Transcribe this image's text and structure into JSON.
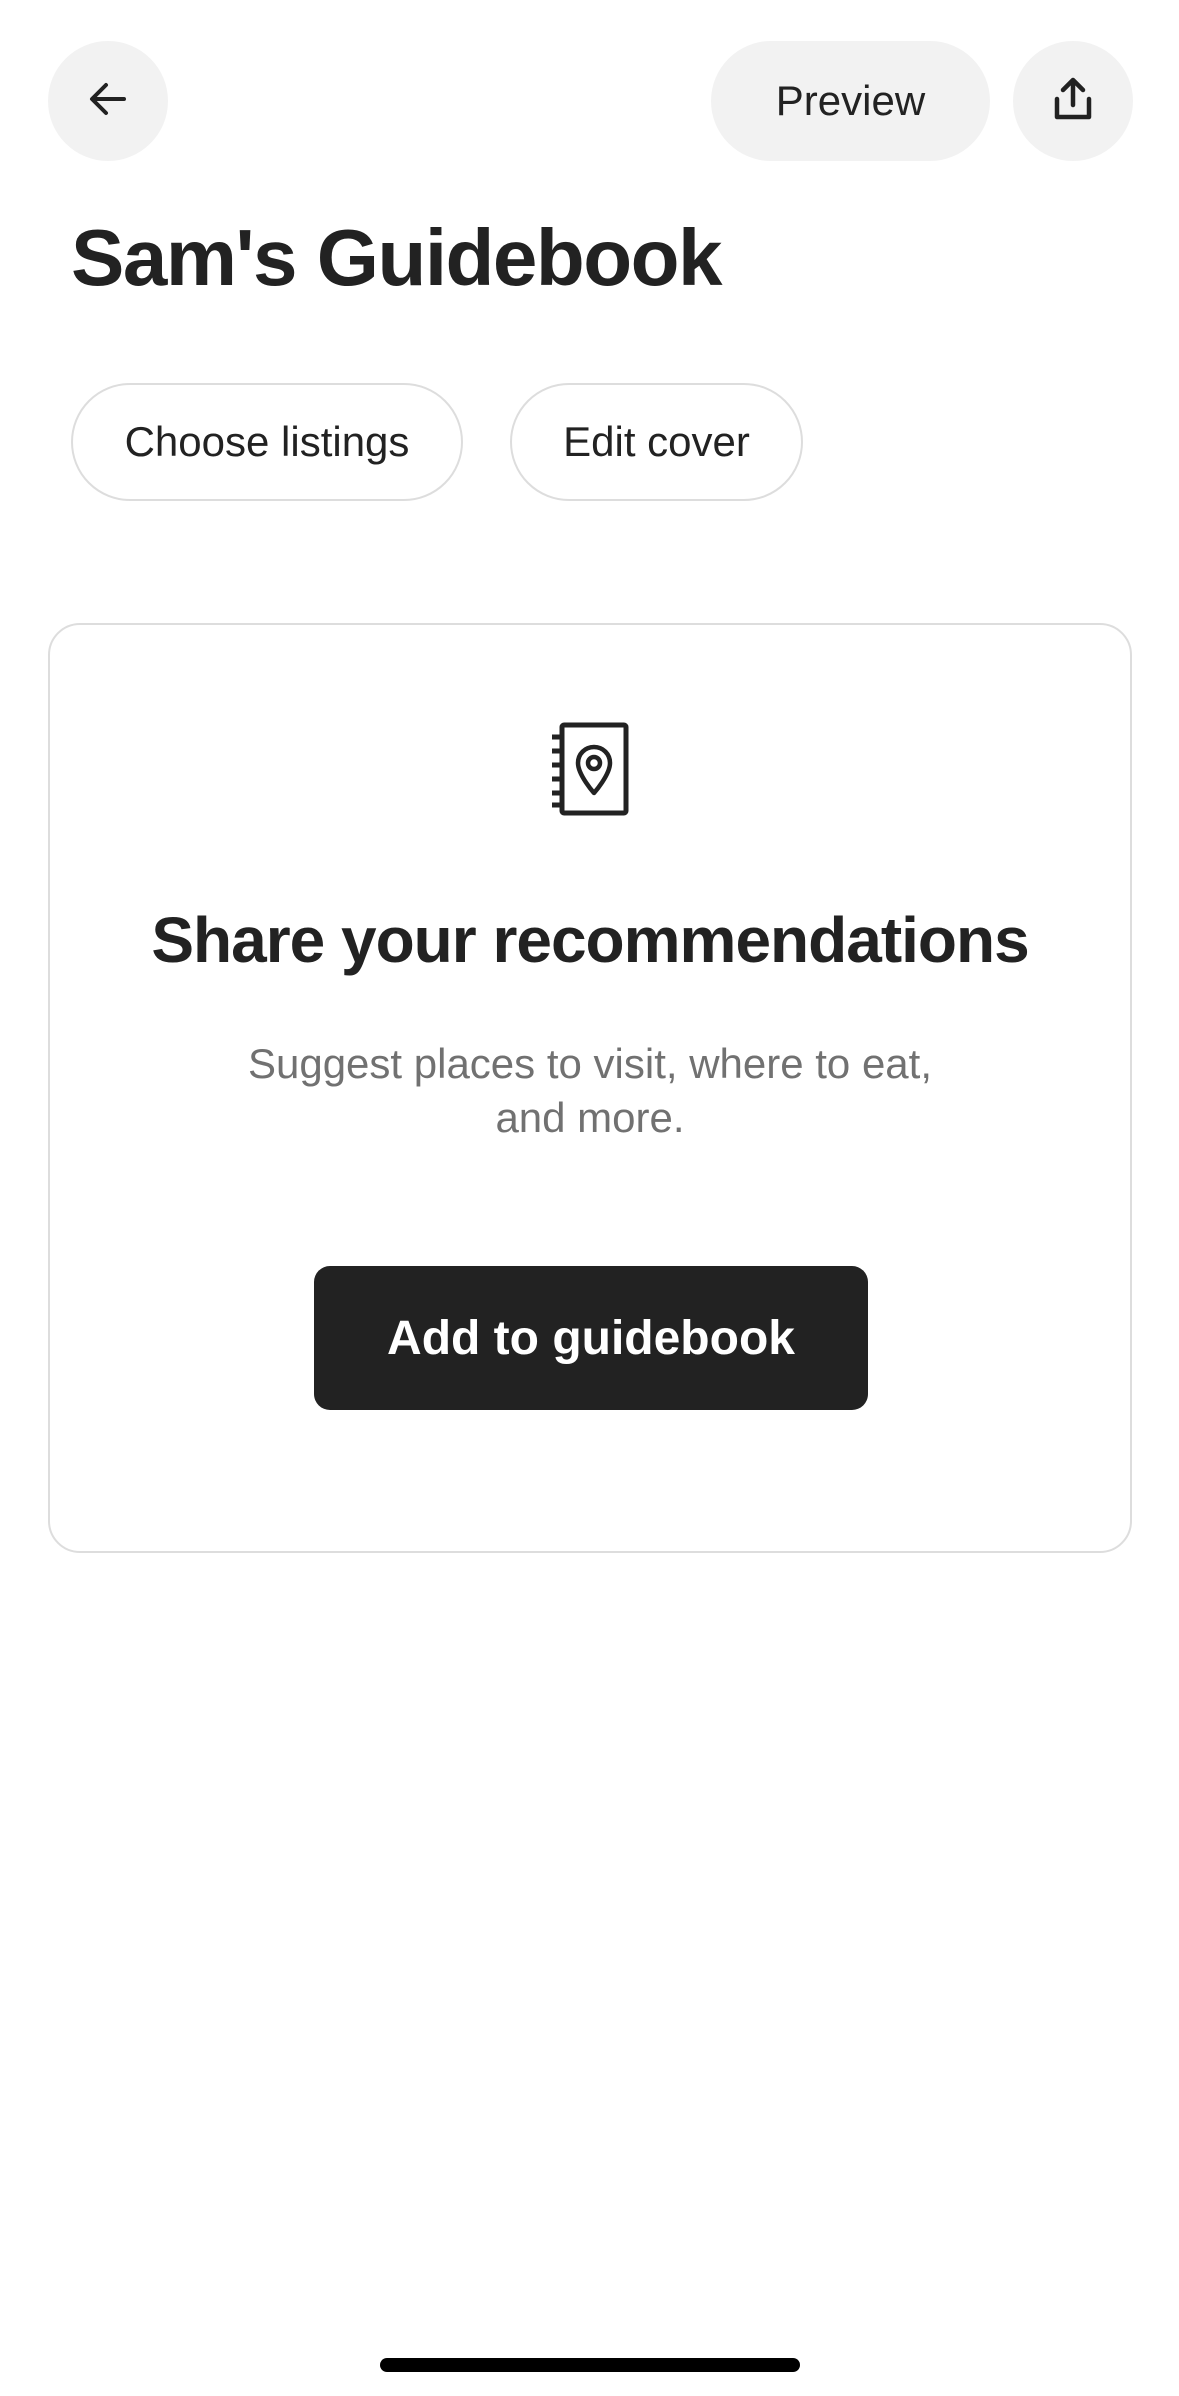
{
  "header": {
    "back_icon": "arrow-left-icon",
    "preview_label": "Preview",
    "share_icon": "share-upload-icon"
  },
  "page": {
    "title": "Sam's Guidebook"
  },
  "chips": {
    "choose_listings": "Choose listings",
    "edit_cover": "Edit cover"
  },
  "empty_state": {
    "icon": "guidebook-location-icon",
    "heading": "Share your recommendations",
    "subtitle": "Suggest places to visit, where to eat, and more.",
    "button_label": "Add to guidebook"
  },
  "colors": {
    "primary_text": "#222222",
    "secondary_text": "#717171",
    "button_bg": "#222222",
    "chip_border": "#dddddd",
    "circle_bg": "#f2f2f2"
  }
}
